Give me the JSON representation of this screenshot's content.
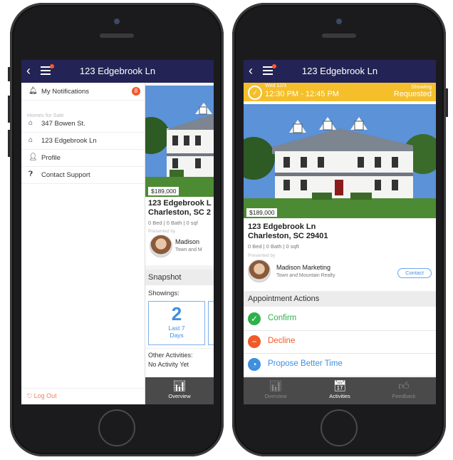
{
  "left_phone": {
    "nav": {
      "title": "123 Edgebrook Ln"
    },
    "drawer": {
      "notifications": {
        "label": "My Notifications",
        "badge": "8"
      },
      "section_label": "Homes for Sale",
      "homes": [
        "347 Bowen St.",
        "123 Edgebrook Ln"
      ],
      "profile": "Profile",
      "support": "Contact Support",
      "logout": "Log Out"
    },
    "peek": {
      "price": "$189,000",
      "address_line1": "123 Edgebrook L",
      "address_line2": "Charleston, SC 2",
      "meta": "0 Bed | 0 Bath | 0 sqf",
      "presented_by": "Presented by",
      "agent_name": "Madison",
      "agent_company": "Town and M",
      "snapshot_title": "Snapshot",
      "showings_label": "Showings:",
      "showings_count": "2",
      "showings_period_line1": "Last 7",
      "showings_period_line2": "Days",
      "other_label": "Other Activities:",
      "other_value": "No Activity Yet"
    },
    "tab": {
      "label": "Overview"
    }
  },
  "right_phone": {
    "nav": {
      "title": "123 Edgebrook Ln"
    },
    "banner": {
      "day": "Wed 12/3",
      "time": "12:30 PM - 12:45 PM",
      "label_top": "Showing",
      "label_bottom": "Requested"
    },
    "listing": {
      "price": "$189,000",
      "address_line1": "123 Edgebrook Ln",
      "address_line2": "Charleston, SC 29401",
      "meta": "0 Bed | 0 Bath | 0 sqft",
      "presented_by": "Presented by",
      "agent_name": "Madison Marketing",
      "agent_company": "Town and Mountain Realty",
      "contact": "Contact"
    },
    "actions_title": "Appointment Actions",
    "actions": [
      {
        "label": "Confirm",
        "color": "#2db14b"
      },
      {
        "label": "Decline",
        "color": "#f05a28"
      },
      {
        "label": "Propose Better Time",
        "color": "#3d8fe0"
      }
    ],
    "tabs": [
      "Overview",
      "Activities",
      "Feedback"
    ]
  },
  "colors": {
    "navbar": "#232355",
    "banner": "#f4bf2b",
    "tabbar": "#4a4a4a"
  }
}
